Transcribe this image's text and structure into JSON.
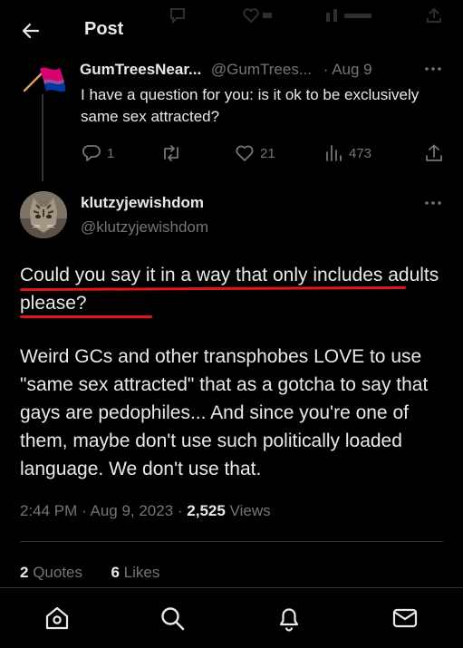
{
  "header": {
    "title": "Post",
    "back_icon": "arrow-left-icon"
  },
  "parent_post": {
    "avatar_icon": "bisexual-flag-icon",
    "flag_colors": [
      "#d60270",
      "#9b4f96",
      "#0038a8"
    ],
    "author_name": "GumTreesNear...",
    "author_handle": "@GumTrees...",
    "date": "· Aug 9",
    "text": "I have a question for you: is it ok to be exclusively same sex attracted?",
    "actions": {
      "replies": "1",
      "reposts": "",
      "likes": "21",
      "views": "473"
    }
  },
  "main_post": {
    "author_name": "klutzyjewishdom",
    "author_handle": "@klutzyjewishdom",
    "paragraph_1": "Could you say it in a way that only includes adults please?",
    "paragraph_2": "Weird GCs and other transphobes LOVE to use \"same sex attracted\" that as a gotcha to say that gays are pedophiles... And since you're one of them, maybe don't use such politically loaded language. We don't use that.",
    "timestamp": "2:44 PM · Aug 9, 2023 · ",
    "views_count": "2,525",
    "views_label": " Views",
    "quotes_count": "2",
    "quotes_label": " Quotes",
    "likes_count": "6",
    "likes_label": " Likes"
  },
  "annotation_color": "#e2161c",
  "bottom_nav": {
    "items": [
      "home-icon",
      "search-icon",
      "notifications-icon",
      "messages-icon"
    ]
  }
}
